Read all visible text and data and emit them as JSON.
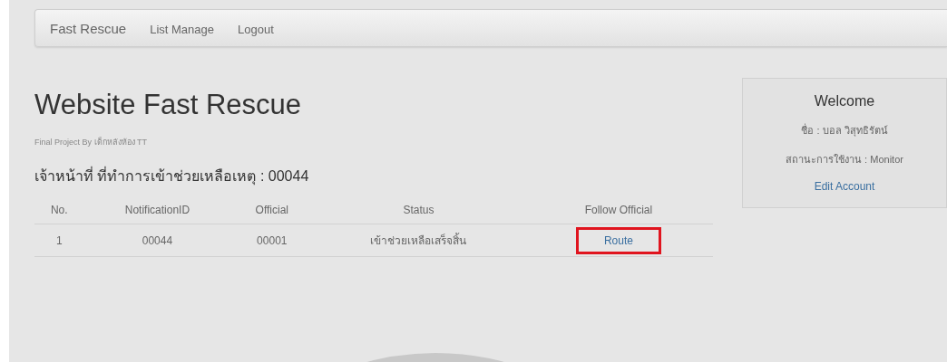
{
  "navbar": {
    "brand": "Fast Rescue",
    "links": [
      "List Manage",
      "Logout"
    ]
  },
  "title": "Website Fast Rescue",
  "subtitle": "Final Project By เด็กหลังห้อง TT",
  "heading": "เจ้าหน้าที่ ที่ทำการเข้าช่วยเหลือเหตุ : 00044",
  "table": {
    "columns": [
      "No.",
      "NotificationID",
      "Official",
      "Status",
      "Follow Official"
    ],
    "rows": [
      {
        "no": "1",
        "notification_id": "00044",
        "official": "00001",
        "status": "เข้าช่วยเหลือเสร็จสิ้น",
        "link": "Route",
        "highlighted": true
      }
    ]
  },
  "welcome": {
    "title": "Welcome",
    "name": "ชื่อ : บอล วิสุทธิรัตน์",
    "role": "สถานะการใช้งาน : Monitor",
    "link": "Edit Account"
  }
}
